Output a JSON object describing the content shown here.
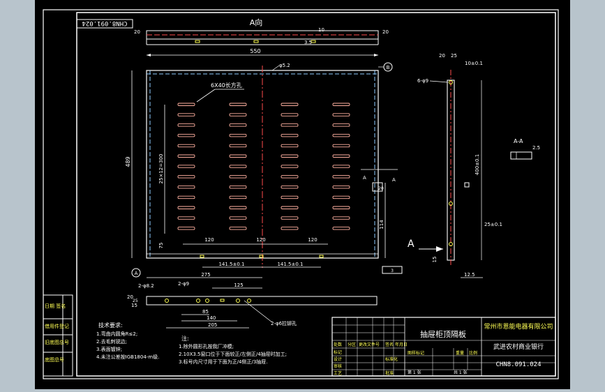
{
  "drawing": {
    "view_label": "A向",
    "rotated_number": "CHN8.091.024",
    "section_label": "A-A",
    "arrow_label": "A",
    "ref_b": "B",
    "ref_a": "A",
    "callout_slots": "6X40长方孔",
    "callout_hole_d": "φ5.2",
    "callout_side_holes": "6-φ9",
    "callout_bottom_holes": "2-φ6拉铆孔",
    "callout_bottom_holes2": "2-φ8.2",
    "callout_bottom_holes3": "2-φ9"
  },
  "dimensions": {
    "width_top": "550",
    "height_left": "489",
    "slot_pitch": "25×12=300",
    "slot_spacing_1": "120",
    "slot_spacing_2": "120",
    "slot_spacing_3": "120",
    "bottom_left_margin": "75",
    "hole_spacing_1": "141.5±0.1",
    "hole_spacing_2": "141.5±0.1",
    "overall_275": "275",
    "dim_125": "125",
    "dim_20_top": "20",
    "dim_20_top_r": "20",
    "dim_10": "10",
    "dim_35": "3.5",
    "side_20": "20",
    "side_25": "25",
    "side_10": "10±0.1",
    "side_400": "400±0.1",
    "side_25b": "25±0.1",
    "side_15": "15",
    "side_125": "12.5",
    "section_25": "2.5",
    "dim_114": "114",
    "dim_20b": "20",
    "dim_85": "85",
    "dim_140": "140",
    "dim_205": "205",
    "dim_20_left": "20",
    "dim_15_left": "15",
    "dim_3": "3",
    "dim_25": "25"
  },
  "tech_req": {
    "title": "技术要求:",
    "lines": [
      "1.弯曲内圆角R≤2;",
      "2.去毛刺锐边;",
      "3.表面镀锌;",
      "4.未注公差按IGB1804-m级."
    ]
  },
  "notes": {
    "title": "注:",
    "lines": [
      "1.除外圆形孔按我厂冲模;",
      "2.10X3.5窗口位于下面较正/左侧正/4抽屉时加工;",
      "3.标号内尺寸用于下面为正/4侧正/3抽屉."
    ]
  },
  "left_strip": [
    "借用件登记",
    "旧底图总号",
    "底图总号",
    "日期 签名"
  ],
  "title_block": {
    "part_name": "抽屉柜顶隔板",
    "company": "常州市恩能电器有限公司",
    "project": "武进农村商业银行",
    "drawing_no": "CHN8.091.024",
    "row_labels": [
      "标记",
      "设计",
      "审核",
      "工艺",
      "标准化",
      "批准"
    ],
    "header_cells": [
      "处数",
      "分区",
      "更改文件号",
      "签名",
      "年月日"
    ],
    "stage_labels": [
      "图样标记",
      "重量",
      "比例"
    ],
    "sheet_text": [
      "共 1 张",
      "第 1 张"
    ]
  }
}
